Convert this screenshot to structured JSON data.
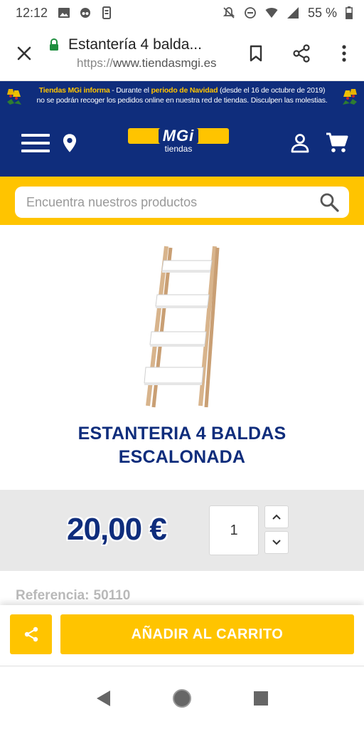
{
  "status_bar": {
    "time": "12:12",
    "battery": "55 %"
  },
  "browser": {
    "tab_title": "Estantería 4 balda...",
    "url_protocol": "https://",
    "url_host": "www.tiendasmgi.es"
  },
  "notice": {
    "part1": "Tiendas MGi informa",
    "part2": " - Durante el ",
    "part3": "periodo de Navidad",
    "part4": " (desde el 16 de octubre de 2019)",
    "line2": "no se podrán recoger los pedidos online en nuestra red de tiendas. Disculpen las molestias."
  },
  "header": {
    "logo_text": "MGi",
    "logo_sub": "tiendas"
  },
  "search": {
    "placeholder": "Encuentra nuestros productos"
  },
  "product": {
    "title_line1": "ESTANTERIA 4 BALDAS",
    "title_line2": "ESCALONADA",
    "price": "20,00 €",
    "quantity": "1",
    "reference_label": "Referencia:",
    "reference_value": "50110"
  },
  "actions": {
    "add_to_cart": "AÑADIR AL CARRITO"
  },
  "colors": {
    "brand_blue": "#0f2d7c",
    "brand_yellow": "#ffc400"
  },
  "icons": {
    "close": "close-icon",
    "lock": "lock-icon",
    "bookmark": "bookmark-icon",
    "share": "share-icon",
    "menu": "more-vert-icon",
    "hamburger": "hamburger-icon",
    "location": "location-pin-icon",
    "account": "user-icon",
    "cart": "cart-icon",
    "search": "search-icon"
  }
}
